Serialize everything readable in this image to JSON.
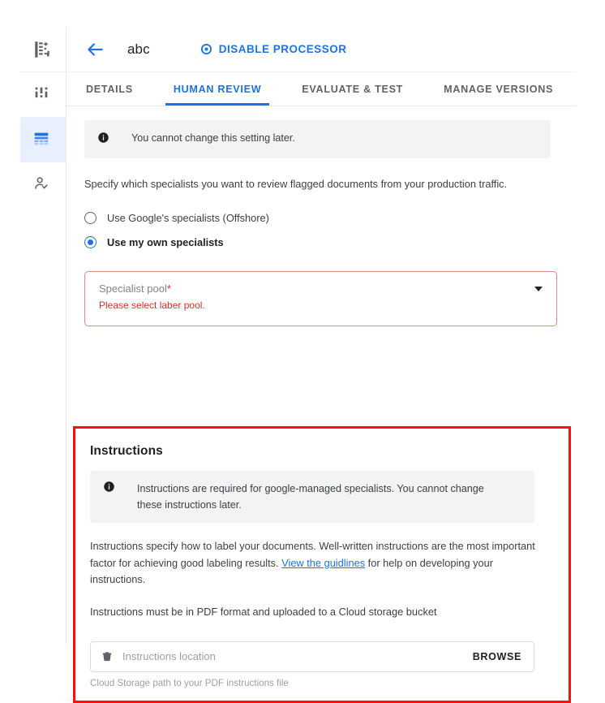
{
  "rail": {
    "items": [
      {
        "name": "document-processing-icon",
        "label": "Document processing",
        "active": false
      },
      {
        "name": "dashboard-icon",
        "label": "Dashboard",
        "active": false
      },
      {
        "name": "processors-table-icon",
        "label": "Processors",
        "active": true
      },
      {
        "name": "human-review-person-check-icon",
        "label": "Human review",
        "active": false
      }
    ]
  },
  "topbar": {
    "back_label": "back-arrow",
    "title": "abc",
    "disable_button": "DISABLE PROCESSOR",
    "disable_icon": "stop-circle-icon",
    "accent_color": "#1a73e8"
  },
  "tabs": [
    {
      "label": "DETAILS",
      "active": false
    },
    {
      "label": "HUMAN REVIEW",
      "active": true
    },
    {
      "label": "EVALUATE & TEST",
      "active": false
    },
    {
      "label": "MANAGE VERSIONS",
      "active": false
    }
  ],
  "main": {
    "info_banner": {
      "icon": "info-icon",
      "text": "You cannot change this setting later."
    },
    "description": "Specify which specialists you want to review flagged documents from your production traffic.",
    "radios": [
      {
        "label": "Use Google's specialists (Offshore)",
        "checked": false
      },
      {
        "label": "Use my own specialists",
        "checked": true
      }
    ],
    "specialist_pool": {
      "label": "Specialist pool",
      "required_marker": "*",
      "error": "Please select laber pool.",
      "caret": "chevron-down-icon",
      "error_color": "#d93025"
    }
  },
  "instructions": {
    "highlight_color": "#fb0f0f",
    "title": "Instructions",
    "info_banner": {
      "icon": "info-icon",
      "text": "Instructions are required for google-managed specialists. You cannot change these instructions later."
    },
    "paragraph_part1": "Instructions specify how to label your documents. Well-written instructions are the most important factor for achieving good labeling results. ",
    "link_text": "View the guidlines",
    "paragraph_part2": " for help on developing your instructions.",
    "paragraph2": "Instructions must be in PDF format and uploaded to a Cloud storage bucket",
    "file_input": {
      "icon": "storage-bucket-icon",
      "placeholder": "Instructions location",
      "browse_label": "BROWSE",
      "hint": "Cloud Storage path to your PDF instructions file"
    }
  }
}
